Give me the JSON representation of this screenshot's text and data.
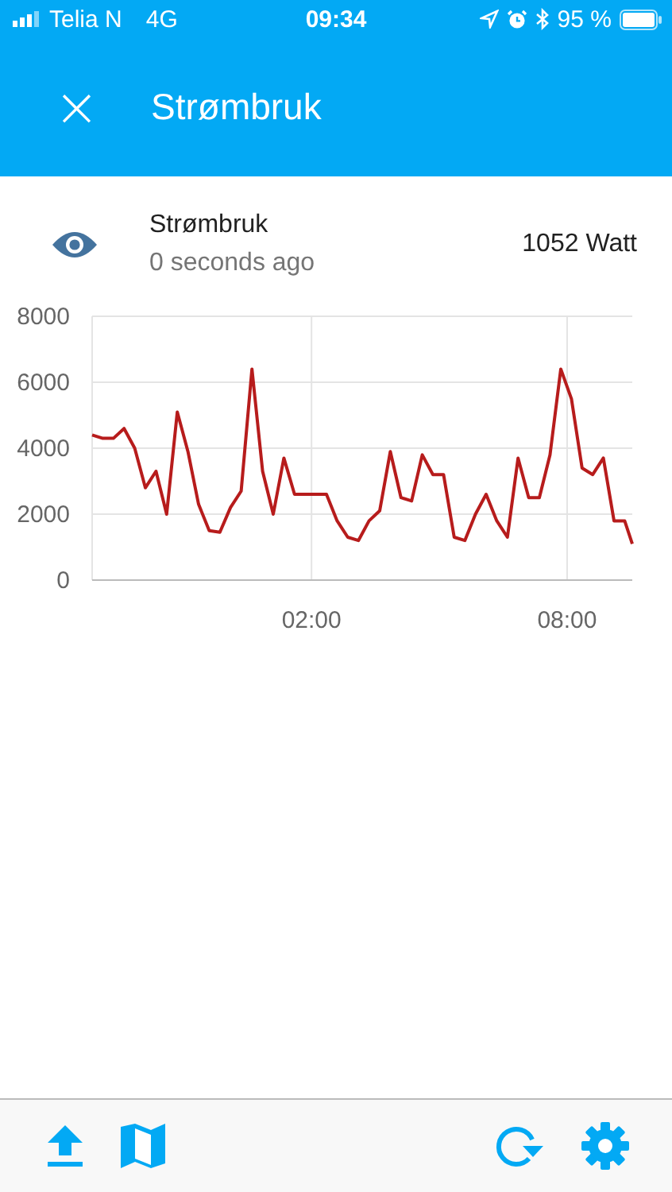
{
  "status_bar": {
    "carrier": "Telia N",
    "network": "4G",
    "time": "09:34",
    "battery": "95 %"
  },
  "header": {
    "close": "×",
    "title": "Strømbruk"
  },
  "entity": {
    "name": "Strømbruk",
    "updated": "0 seconds ago",
    "state": "1052 Watt"
  },
  "chart": {
    "chart_data": {
      "type": "line",
      "x": [
        -3.15,
        -2.9,
        -2.65,
        -2.4,
        -2.15,
        -1.9,
        -1.65,
        -1.4,
        -1.15,
        -0.9,
        -0.65,
        -0.4,
        -0.15,
        0.1,
        0.35,
        0.6,
        0.85,
        1.1,
        1.35,
        1.6,
        1.85,
        2.1,
        2.35,
        2.6,
        2.85,
        3.1,
        3.35,
        3.6,
        3.85,
        4.1,
        4.35,
        4.6,
        4.85,
        5.1,
        5.35,
        5.6,
        5.85,
        6.1,
        6.35,
        6.6,
        6.85,
        7.1,
        7.35,
        7.6,
        7.85,
        8.1,
        8.35,
        8.6,
        8.85,
        9.1,
        9.35,
        9.53
      ],
      "series": [
        {
          "color": "#b71c1c",
          "values": [
            4400,
            4300,
            4300,
            4600,
            4000,
            2800,
            3300,
            2000,
            5100,
            3900,
            2300,
            1500,
            1450,
            2200,
            2700,
            6400,
            3300,
            2000,
            3700,
            2600,
            2600,
            2600,
            2600,
            1800,
            1300,
            1200,
            1800,
            2100,
            3900,
            2500,
            2400,
            3800,
            3200,
            3200,
            1300,
            1200,
            2000,
            2600,
            1800,
            1300,
            3700,
            2500,
            2500,
            3800,
            6400,
            5500,
            3400,
            3200,
            3700,
            1800,
            1800,
            1100
          ]
        }
      ],
      "xlim": [
        -3.15,
        9.53
      ],
      "ylim": [
        0,
        8000
      ],
      "xticks": [
        {
          "value": 2,
          "label": "02:00"
        },
        {
          "value": 8,
          "label": "08:00"
        }
      ],
      "yticks": [
        0,
        2000,
        4000,
        6000,
        8000
      ],
      "grid": true
    }
  },
  "toolbar": [
    {
      "kind": "upload"
    },
    {
      "kind": "map"
    },
    {
      "kind": "refresh"
    },
    {
      "kind": "settings"
    }
  ]
}
